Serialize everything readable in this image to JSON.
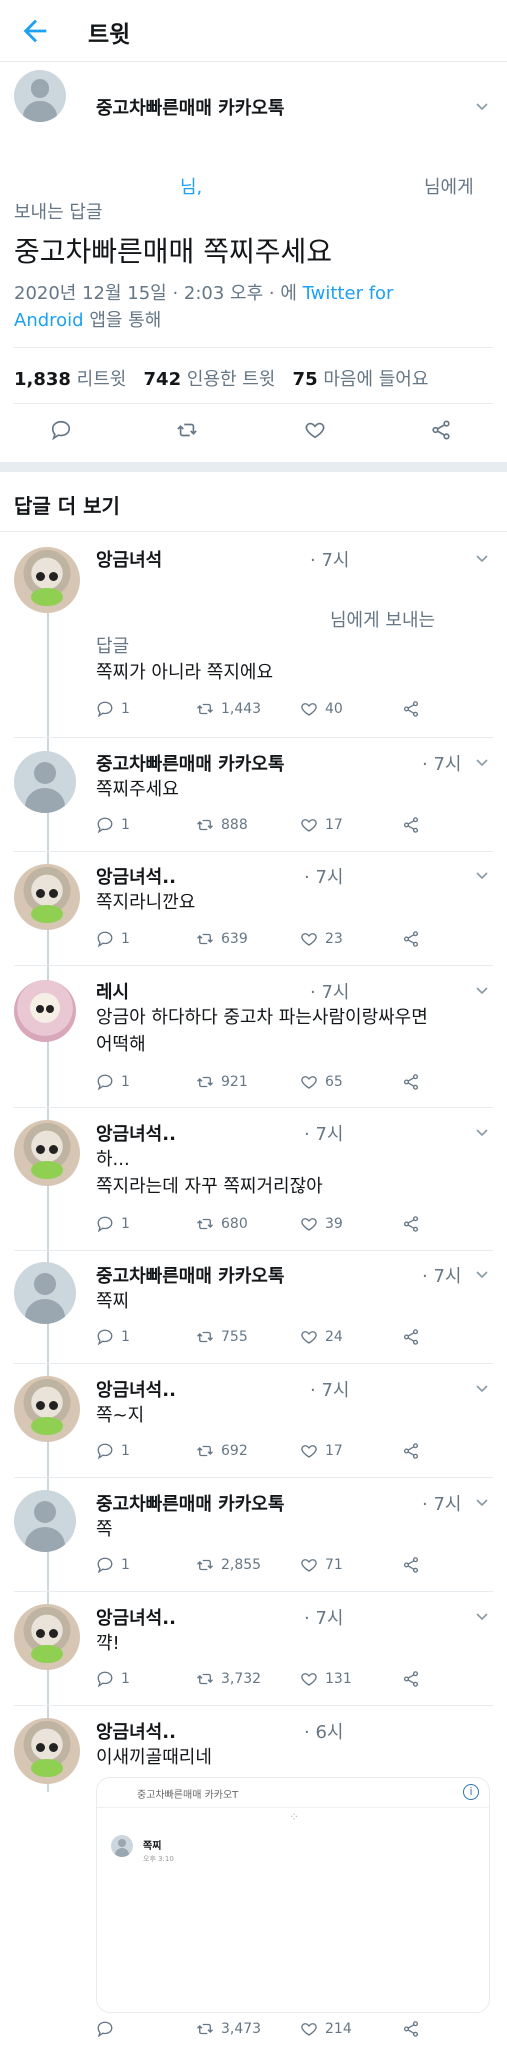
{
  "header": {
    "title": "트윗"
  },
  "tweet": {
    "author": "중고차빠른매매 카카오톡",
    "reply_to_prefix": "님,",
    "reply_to_suffix": "님에게",
    "reply_to_line2": "보내는 답글",
    "text": "중고차빠른매매 쪽찌주세요",
    "meta_line1_date": "2020년 12월 15일 · 2:03 오후 · 에",
    "meta_line1_link": "Twitter for",
    "meta_line2_link": "Android",
    "meta_line2_rest": "앱을 통해",
    "stats": {
      "retweets_num": "1,838",
      "retweets_label": "리트윗",
      "quotes_num": "742",
      "quotes_label": "인용한 트윗",
      "likes_num": "75",
      "likes_label": "마음에 들어요"
    }
  },
  "more_replies_title": "답글 더 보기",
  "replies": [
    {
      "author": "앙금녀석",
      "time": "· 7시",
      "reply_line": "님에게 보내는",
      "reply_line2": "답글",
      "text": "쪽찌가 아니라 쪽지에요",
      "replies": "1",
      "retweets": "1,443",
      "likes": "40"
    },
    {
      "author": "중고차빠른매매 카카오톡",
      "time": "· 7시",
      "text": "쪽찌주세요",
      "replies": "1",
      "retweets": "888",
      "likes": "17"
    },
    {
      "author": "앙금녀석..",
      "time": "· 7시",
      "text": "쪽지라니깐요",
      "replies": "1",
      "retweets": "639",
      "likes": "23"
    },
    {
      "author": "레시",
      "time": "· 7시",
      "text": "앙금아 하다하다 중고차 파는사람이랑싸우면",
      "text2": "어떡해",
      "replies": "1",
      "retweets": "921",
      "likes": "65"
    },
    {
      "author": "앙금녀석..",
      "time": "· 7시",
      "text": "하...",
      "text2": "쪽지라는데 자꾸 쪽찌거리잖아",
      "replies": "1",
      "retweets": "680",
      "likes": "39"
    },
    {
      "author": "중고차빠른매매 카카오톡",
      "time": "· 7시",
      "text": "쪽찌",
      "replies": "1",
      "retweets": "755",
      "likes": "24"
    },
    {
      "author": "앙금녀석..",
      "time": "· 7시",
      "text": "쪽~지",
      "replies": "1",
      "retweets": "692",
      "likes": "17"
    },
    {
      "author": "중고차빠른매매 카카오톡",
      "time": "· 7시",
      "text": "쪽",
      "replies": "1",
      "retweets": "2,855",
      "likes": "71"
    },
    {
      "author": "앙금녀석..",
      "time": "· 7시",
      "text": "꺅!",
      "replies": "1",
      "retweets": "3,732",
      "likes": "131"
    },
    {
      "author": "앙금녀석..",
      "time": "· 6시",
      "text": "이새끼골때리네",
      "replies": "",
      "retweets": "3,473",
      "likes": "214"
    }
  ],
  "embedded": {
    "title": "중고차빠른매매 카카오T",
    "msg": "쪽찌",
    "time": "오후 3:10"
  },
  "colors": {
    "accent": "#1da1f2",
    "muted": "#657786",
    "divider": "#e6ecf0"
  }
}
